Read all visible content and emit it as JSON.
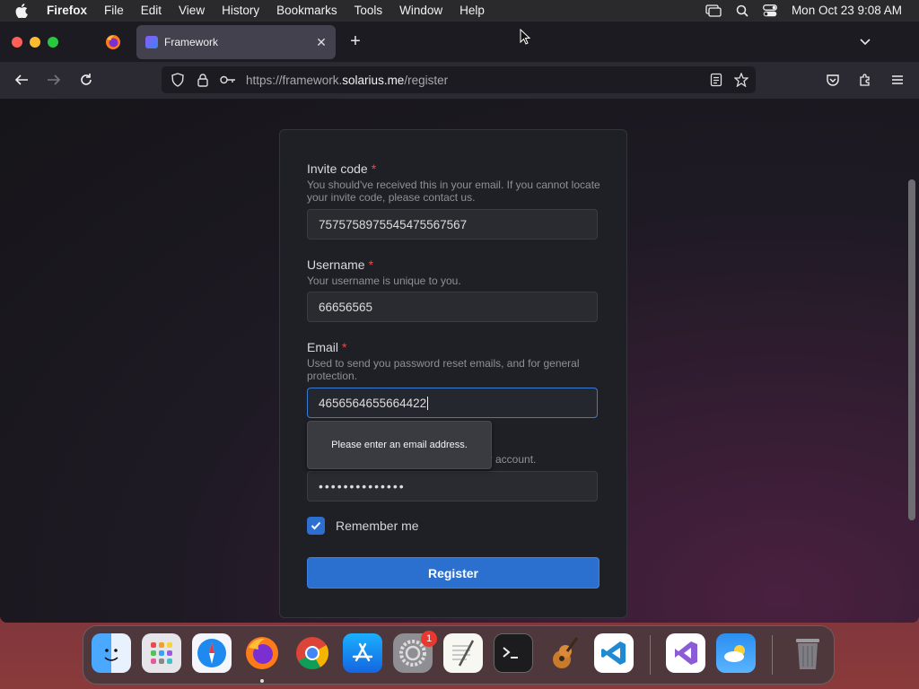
{
  "menubar": {
    "app": "Firefox",
    "items": [
      "File",
      "Edit",
      "View",
      "History",
      "Bookmarks",
      "Tools",
      "Window",
      "Help"
    ],
    "clock": "Mon Oct 23  9:08 AM"
  },
  "browser": {
    "tab_title": "Framework",
    "url_prefix": "https://framework.",
    "url_domain": "solarius.me",
    "url_path": "/register"
  },
  "form": {
    "invite": {
      "label": "Invite code",
      "required": "*",
      "description": "You should've received this in your email. If you cannot locate your invite code, please contact us.",
      "value": "7575758975545475567567"
    },
    "username": {
      "label": "Username",
      "required": "*",
      "description": "Your username is unique to you.",
      "value": "66656565"
    },
    "email": {
      "label": "Email",
      "required": "*",
      "description": "Used to send you password reset emails, and for general protection.",
      "value": "4656564655664422"
    },
    "validation_tooltip": "Please enter an email address.",
    "password_desc_partial": "ur account.",
    "password_value": "••••••••••••••",
    "remember_label": "Remember me",
    "remember_checked": true,
    "register_label": "Register"
  },
  "dock": {
    "apps": [
      "Finder",
      "Launchpad",
      "Safari",
      "Firefox",
      "Chrome",
      "App Store",
      "System Settings",
      "TextEdit",
      "Terminal",
      "GarageBand",
      "Visual Studio Code",
      "Visual Studio",
      "Weather",
      "Trash"
    ],
    "settings_badge": "1"
  },
  "colors": {
    "accent": "#2b70cf",
    "required": "#e34b4b",
    "card": "#1f2026"
  }
}
